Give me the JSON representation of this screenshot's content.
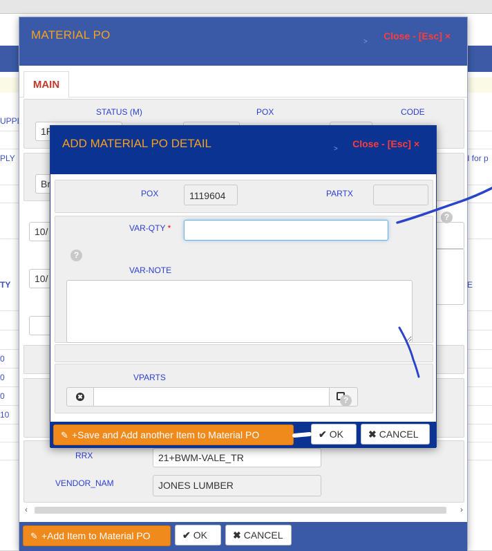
{
  "background": {
    "left_fragments": [
      "UPPL",
      "PLY",
      "TY",
      "0",
      "0",
      "0",
      "10"
    ],
    "right_fragments": [
      "ed for p",
      "E"
    ],
    "date_prefix_1": "10/",
    "date_prefix_2": "10/",
    "status_fragment": "1R",
    "br_fragment": "Br"
  },
  "outer_modal": {
    "title": "MATERIAL PO",
    "close_label": "Close - [Esc] ×",
    "tab_main": "MAIN",
    "labels": {
      "status": "STATUS (M)",
      "pox": "POX",
      "code": "CODE",
      "rrx": "RRX",
      "vendor_nam": "VENDOR_NAM"
    },
    "values": {
      "rrx": "21+BWM-VALE_TR",
      "vendor_nam": "JONES LUMBER"
    },
    "footer": {
      "add_item_label": "+Add Item to Material PO",
      "ok_label": "OK",
      "cancel_label": "CANCEL"
    }
  },
  "inner_modal": {
    "title": "ADD MATERIAL PO DETAIL",
    "close_label": "Close - [Esc] ×",
    "labels": {
      "pox": "POX",
      "partx": "PARTX",
      "var_qty": "VAR-QTY",
      "required_mark": "*",
      "var_note": "VAR-NOTE",
      "vparts": "VPARTS"
    },
    "values": {
      "pox": "1119604",
      "partx": "",
      "var_qty": "",
      "var_note": "",
      "vparts": ""
    },
    "footer": {
      "save_add_label": "+Save and Add another Item to Material PO",
      "ok_label": "OK",
      "cancel_label": "CANCEL"
    }
  },
  "icons": {
    "pencil": "✎",
    "check": "✔",
    "cross": "✖",
    "help": "?",
    "arrow_left": "‹",
    "arrow_right": "›"
  },
  "colors": {
    "header_blue": "#3a5aa7",
    "inner_header_blue": "#0b3391",
    "title_orange": "#f7a11d",
    "close_red": "#ff3b3b",
    "label_blue": "#2a3fd1",
    "button_orange": "#f08a1c",
    "annotation_ink": "#2a45c9"
  }
}
